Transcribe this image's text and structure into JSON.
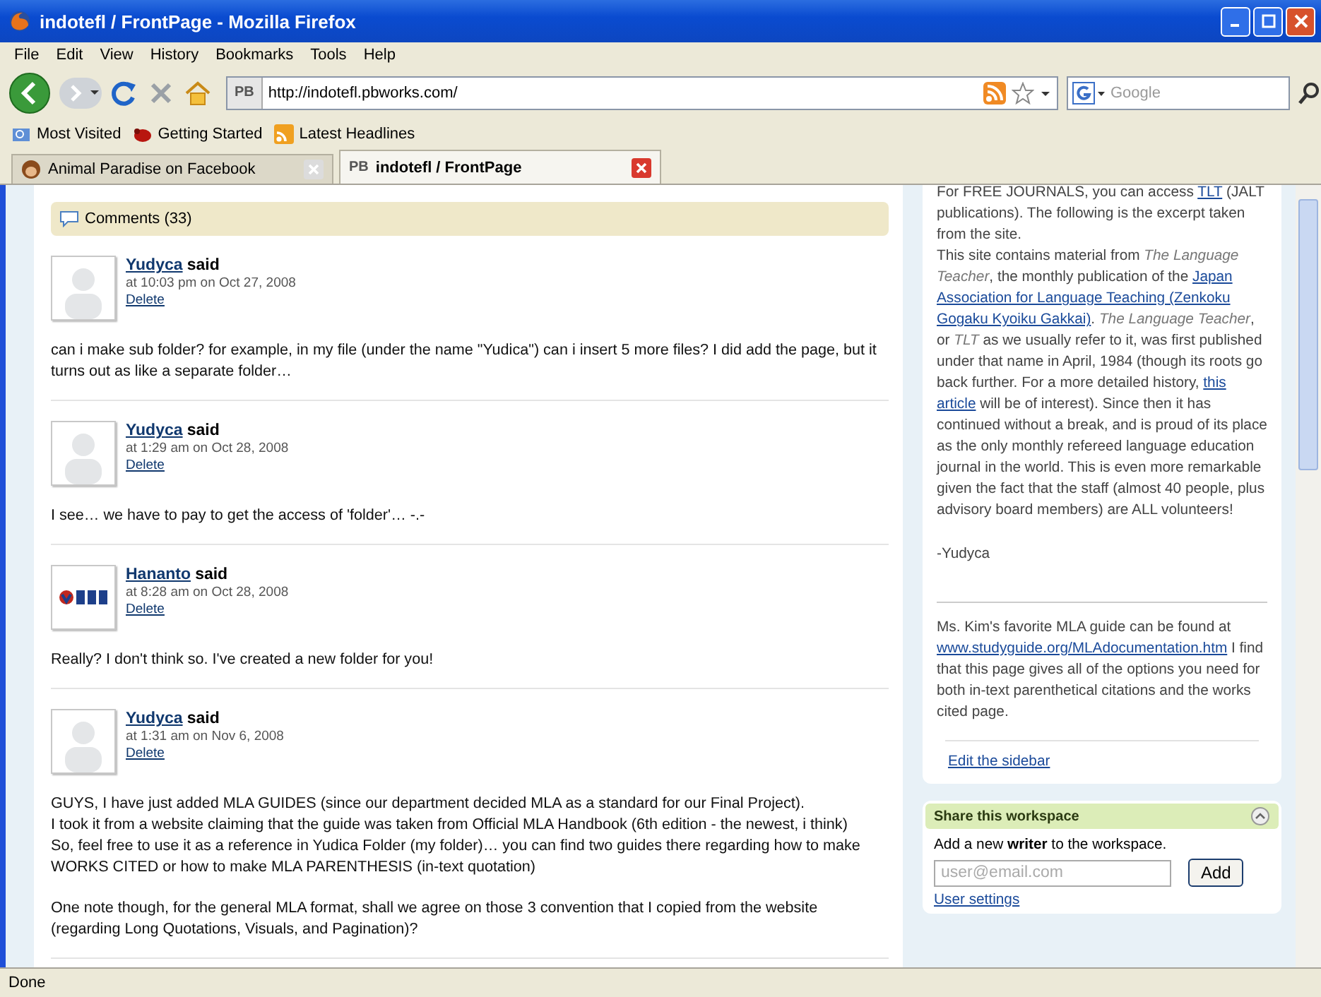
{
  "window": {
    "title": "indotefl / FrontPage - Mozilla Firefox"
  },
  "menu": [
    "File",
    "Edit",
    "View",
    "History",
    "Bookmarks",
    "Tools",
    "Help"
  ],
  "toolbar": {
    "site_badge": "PB",
    "url": "http://indotefl.pbworks.com/",
    "search_placeholder": "Google"
  },
  "bookmarks": [
    {
      "label": "Most Visited",
      "kind": "folder"
    },
    {
      "label": "Getting Started",
      "kind": "bug"
    },
    {
      "label": "Latest Headlines",
      "kind": "feed"
    }
  ],
  "tabs": [
    {
      "label": "Animal Paradise on Facebook",
      "selected": false
    },
    {
      "label": "indotefl / FrontPage",
      "badge": "PB",
      "selected": true
    }
  ],
  "comments_header": "Comments (33)",
  "comments": [
    {
      "author": "Yudyca",
      "said": "said",
      "time": "at 10:03 pm on Oct 27, 2008",
      "delete": "Delete",
      "avatar": {
        "kind": "blank"
      },
      "paragraphs": [
        "can i make sub folder? for example, in my file (under the name \"Yudica\") can i insert 5 more files? I did add the page, but it turns out as like a separate folder…"
      ]
    },
    {
      "author": "Yudyca",
      "said": "said",
      "time": "at 1:29 am on Oct 28, 2008",
      "delete": "Delete",
      "avatar": {
        "kind": "blank"
      },
      "paragraphs": [
        "I see… we have to pay to get the access of 'folder'… -.-"
      ]
    },
    {
      "author": "Hananto",
      "said": "said",
      "time": "at 8:28 am on Oct 28, 2008",
      "delete": "Delete",
      "avatar": {
        "kind": "logo"
      },
      "paragraphs": [
        "Really? I don't think so. I've created a new folder for you!"
      ]
    },
    {
      "author": "Yudyca",
      "said": "said",
      "time": "at 1:31 am on Nov 6, 2008",
      "delete": "Delete",
      "avatar": {
        "kind": "blank"
      },
      "paragraphs": [
        "GUYS, I have just added MLA GUIDES (since our department decided MLA as a standard for our Final Project).\nI took it from a website claiming that the guide was taken from Official MLA Handbook (6th edition - the newest, i think)\nSo, feel free to use it as a reference in Yudica Folder (my folder)… you can find two guides there regarding how to make WORKS CITED or how to make MLA PARENTHESIS (in-text quotation)",
        "One note though, for the general MLA format, shall we agree on those 3 convention that I copied from the website (regarding Long Quotations, Visuals, and Pagination)?"
      ]
    }
  ],
  "sidebar": {
    "paragraphs": [
      [
        {
          "kind": "text",
          "text": "For FREE JOURNALS, you can access "
        },
        {
          "kind": "link",
          "text": "TLT"
        },
        {
          "kind": "text",
          "text": " (JALT publications). The following is the excerpt taken from the site."
        }
      ],
      [
        {
          "kind": "text",
          "text": "This site contains material from "
        },
        {
          "kind": "italic",
          "text": "The Language Teacher"
        },
        {
          "kind": "text",
          "text": ", the monthly publication of the "
        },
        {
          "kind": "link",
          "text": "Japan"
        },
        {
          "kind": "space"
        },
        {
          "kind": "link",
          "text": "Association for Language Teaching (Zenkoku"
        },
        {
          "kind": "space"
        },
        {
          "kind": "link",
          "text": "Gogaku Kyoiku Gakkai)"
        },
        {
          "kind": "text",
          "text": ". "
        },
        {
          "kind": "italic",
          "text": "The Language Teacher"
        },
        {
          "kind": "text",
          "text": ", or "
        },
        {
          "kind": "italic",
          "text": "TLT"
        },
        {
          "kind": "text",
          "text": " as we usually refer to it, was first published under that name in April, 1984 (though its roots go back further. For a more detailed history, "
        },
        {
          "kind": "link",
          "text": "this"
        },
        {
          "kind": "space"
        },
        {
          "kind": "link",
          "text": "article"
        },
        {
          "kind": "text",
          "text": " will be of interest). Since then it has continued without a break, and is proud of its place as the only monthly refereed language education journal in the world. This is even more remarkable given the fact that the staff (almost 40 people, plus advisory board members) are ALL volunteers!"
        }
      ],
      [
        {
          "kind": "text",
          "text": "-Yudyca"
        }
      ]
    ],
    "note": [
      {
        "kind": "text",
        "text": "Ms. Kim's favorite MLA guide can be found at "
      },
      {
        "kind": "link",
        "text": "www.studyguide.org/MLAdocumentation.htm"
      },
      {
        "kind": "text",
        "text": "  I find that this page gives all of the options you need for both in-text parenthetical citations and the works cited page."
      }
    ],
    "edit_link": "Edit the sidebar"
  },
  "share": {
    "title": "Share this workspace",
    "prompt": "Add a new **writer** to the workspace.",
    "email_placeholder": "user@email.com",
    "add_button": "Add",
    "settings_link": "User settings"
  },
  "status_bar": "Done"
}
